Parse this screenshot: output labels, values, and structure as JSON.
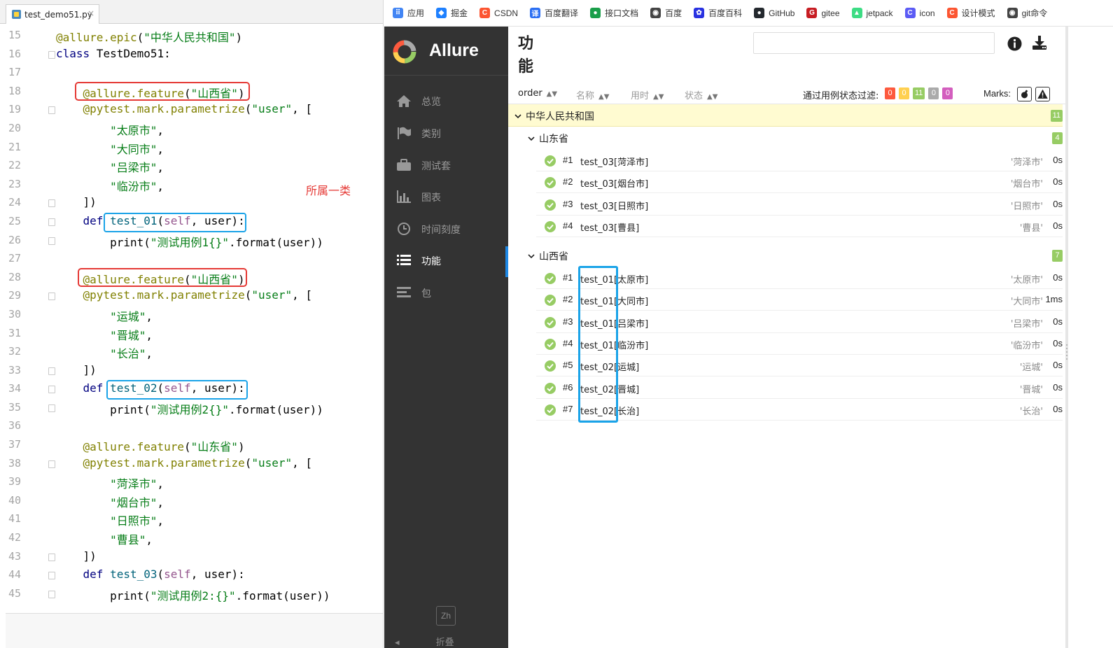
{
  "editor": {
    "tab_label": "test_demo51.py",
    "note": "所属一类",
    "lines": [
      {
        "n": "15",
        "t": "@allure.epic(\"中华人民共和国\")"
      },
      {
        "n": "16",
        "t": "class TestDemo51:"
      },
      {
        "n": "17",
        "t": ""
      },
      {
        "n": "18",
        "t": "    @allure.feature(\"山西省\")"
      },
      {
        "n": "19",
        "t": "    @pytest.mark.parametrize(\"user\", ["
      },
      {
        "n": "20",
        "t": "        \"太原市\","
      },
      {
        "n": "21",
        "t": "        \"大同市\","
      },
      {
        "n": "22",
        "t": "        \"吕梁市\","
      },
      {
        "n": "23",
        "t": "        \"临汾市\","
      },
      {
        "n": "24",
        "t": "    ])"
      },
      {
        "n": "25",
        "t": "    def test_01(self, user):"
      },
      {
        "n": "26",
        "t": "        print(\"测试用例1{}\".format(user))"
      },
      {
        "n": "27",
        "t": ""
      },
      {
        "n": "28",
        "t": "    @allure.feature(\"山西省\")"
      },
      {
        "n": "29",
        "t": "    @pytest.mark.parametrize(\"user\", ["
      },
      {
        "n": "30",
        "t": "        \"运城\","
      },
      {
        "n": "31",
        "t": "        \"晋城\","
      },
      {
        "n": "32",
        "t": "        \"长治\","
      },
      {
        "n": "33",
        "t": "    ])"
      },
      {
        "n": "34",
        "t": "    def test_02(self, user):"
      },
      {
        "n": "35",
        "t": "        print(\"测试用例2{}\".format(user))"
      },
      {
        "n": "36",
        "t": ""
      },
      {
        "n": "37",
        "t": "    @allure.feature(\"山东省\")"
      },
      {
        "n": "38",
        "t": "    @pytest.mark.parametrize(\"user\", ["
      },
      {
        "n": "39",
        "t": "        \"菏泽市\","
      },
      {
        "n": "40",
        "t": "        \"烟台市\","
      },
      {
        "n": "41",
        "t": "        \"日照市\","
      },
      {
        "n": "42",
        "t": "        \"曹县\","
      },
      {
        "n": "43",
        "t": "    ])"
      },
      {
        "n": "44",
        "t": "    def test_03(self, user):"
      },
      {
        "n": "45",
        "t": "        print(\"测试用例2:{}\".format(user))"
      }
    ]
  },
  "bookmarks": [
    {
      "label": "应用",
      "icon": "apps-grid-icon",
      "color": "#4285f4"
    },
    {
      "label": "掘金",
      "icon": "juejin-icon",
      "color": "#1e80ff"
    },
    {
      "label": "CSDN",
      "icon": "csdn-icon",
      "color": "#fc5531"
    },
    {
      "label": "百度翻译",
      "icon": "baidu-translate-icon",
      "color": "#2b6ff3"
    },
    {
      "label": "接口文档",
      "icon": "api-doc-icon",
      "color": "#1a9e4a"
    },
    {
      "label": "百度",
      "icon": "globe-icon",
      "color": "#444444"
    },
    {
      "label": "百度百科",
      "icon": "baidu-paw-icon",
      "color": "#2932e1"
    },
    {
      "label": "GitHub",
      "icon": "github-icon",
      "color": "#24292e"
    },
    {
      "label": "gitee",
      "icon": "gitee-icon",
      "color": "#c71d23"
    },
    {
      "label": "jetpack",
      "icon": "android-icon",
      "color": "#3ddc84"
    },
    {
      "label": "icon",
      "icon": "iconfont-icon",
      "color": "#5b5bf5"
    },
    {
      "label": "设计模式",
      "icon": "csdn-icon",
      "color": "#fc5531"
    },
    {
      "label": "git命令",
      "icon": "globe-icon",
      "color": "#444444"
    }
  ],
  "allure": {
    "brand": "Allure",
    "lang": "Zh",
    "collapse": "折叠",
    "nav": [
      {
        "label": "总览",
        "icon": "home-icon"
      },
      {
        "label": "类别",
        "icon": "flag-icon"
      },
      {
        "label": "测试套",
        "icon": "briefcase-icon"
      },
      {
        "label": "图表",
        "icon": "bar-chart-icon"
      },
      {
        "label": "时间刻度",
        "icon": "clock-icon"
      },
      {
        "label": "功能",
        "icon": "list-icon"
      },
      {
        "label": "包",
        "icon": "package-icon"
      }
    ],
    "active_nav": "功能",
    "page_title": "功能",
    "columns": {
      "order": "order",
      "name": "名称",
      "duration": "用时",
      "status": "状态"
    },
    "filter_label": "通过用例状态过滤:",
    "status_filters": [
      {
        "value": "0",
        "color": "#fd5a3e"
      },
      {
        "value": "0",
        "color": "#ffd050"
      },
      {
        "value": "11",
        "color": "#97cc64"
      },
      {
        "value": "0",
        "color": "#aaaaaa"
      },
      {
        "value": "0",
        "color": "#d35ebe"
      }
    ],
    "marks_label": "Marks:",
    "epic": {
      "name": "中华人民共和国",
      "count": "11"
    },
    "features": [
      {
        "name": "山东省",
        "count": "4",
        "tests": [
          {
            "num": "#1",
            "name": "test_03[菏泽市]",
            "param": "'菏泽市'",
            "duration": "0s"
          },
          {
            "num": "#2",
            "name": "test_03[烟台市]",
            "param": "'烟台市'",
            "duration": "0s"
          },
          {
            "num": "#3",
            "name": "test_03[日照市]",
            "param": "'日照市'",
            "duration": "0s"
          },
          {
            "num": "#4",
            "name": "test_03[曹县]",
            "param": "'曹县'",
            "duration": "0s"
          }
        ]
      },
      {
        "name": "山西省",
        "count": "7",
        "tests": [
          {
            "num": "#1",
            "name": "test_01[太原市]",
            "param": "'太原市'",
            "duration": "0s"
          },
          {
            "num": "#2",
            "name": "test_01[大同市]",
            "param": "'大同市'",
            "duration": "1ms"
          },
          {
            "num": "#3",
            "name": "test_01[吕梁市]",
            "param": "'吕梁市'",
            "duration": "0s"
          },
          {
            "num": "#4",
            "name": "test_01[临汾市]",
            "param": "'临汾市'",
            "duration": "0s"
          },
          {
            "num": "#5",
            "name": "test_02[运城]",
            "param": "'运城'",
            "duration": "0s"
          },
          {
            "num": "#6",
            "name": "test_02[晋城]",
            "param": "'晋城'",
            "duration": "0s"
          },
          {
            "num": "#7",
            "name": "test_02[长治]",
            "param": "'长治'",
            "duration": "0s"
          }
        ]
      }
    ]
  }
}
